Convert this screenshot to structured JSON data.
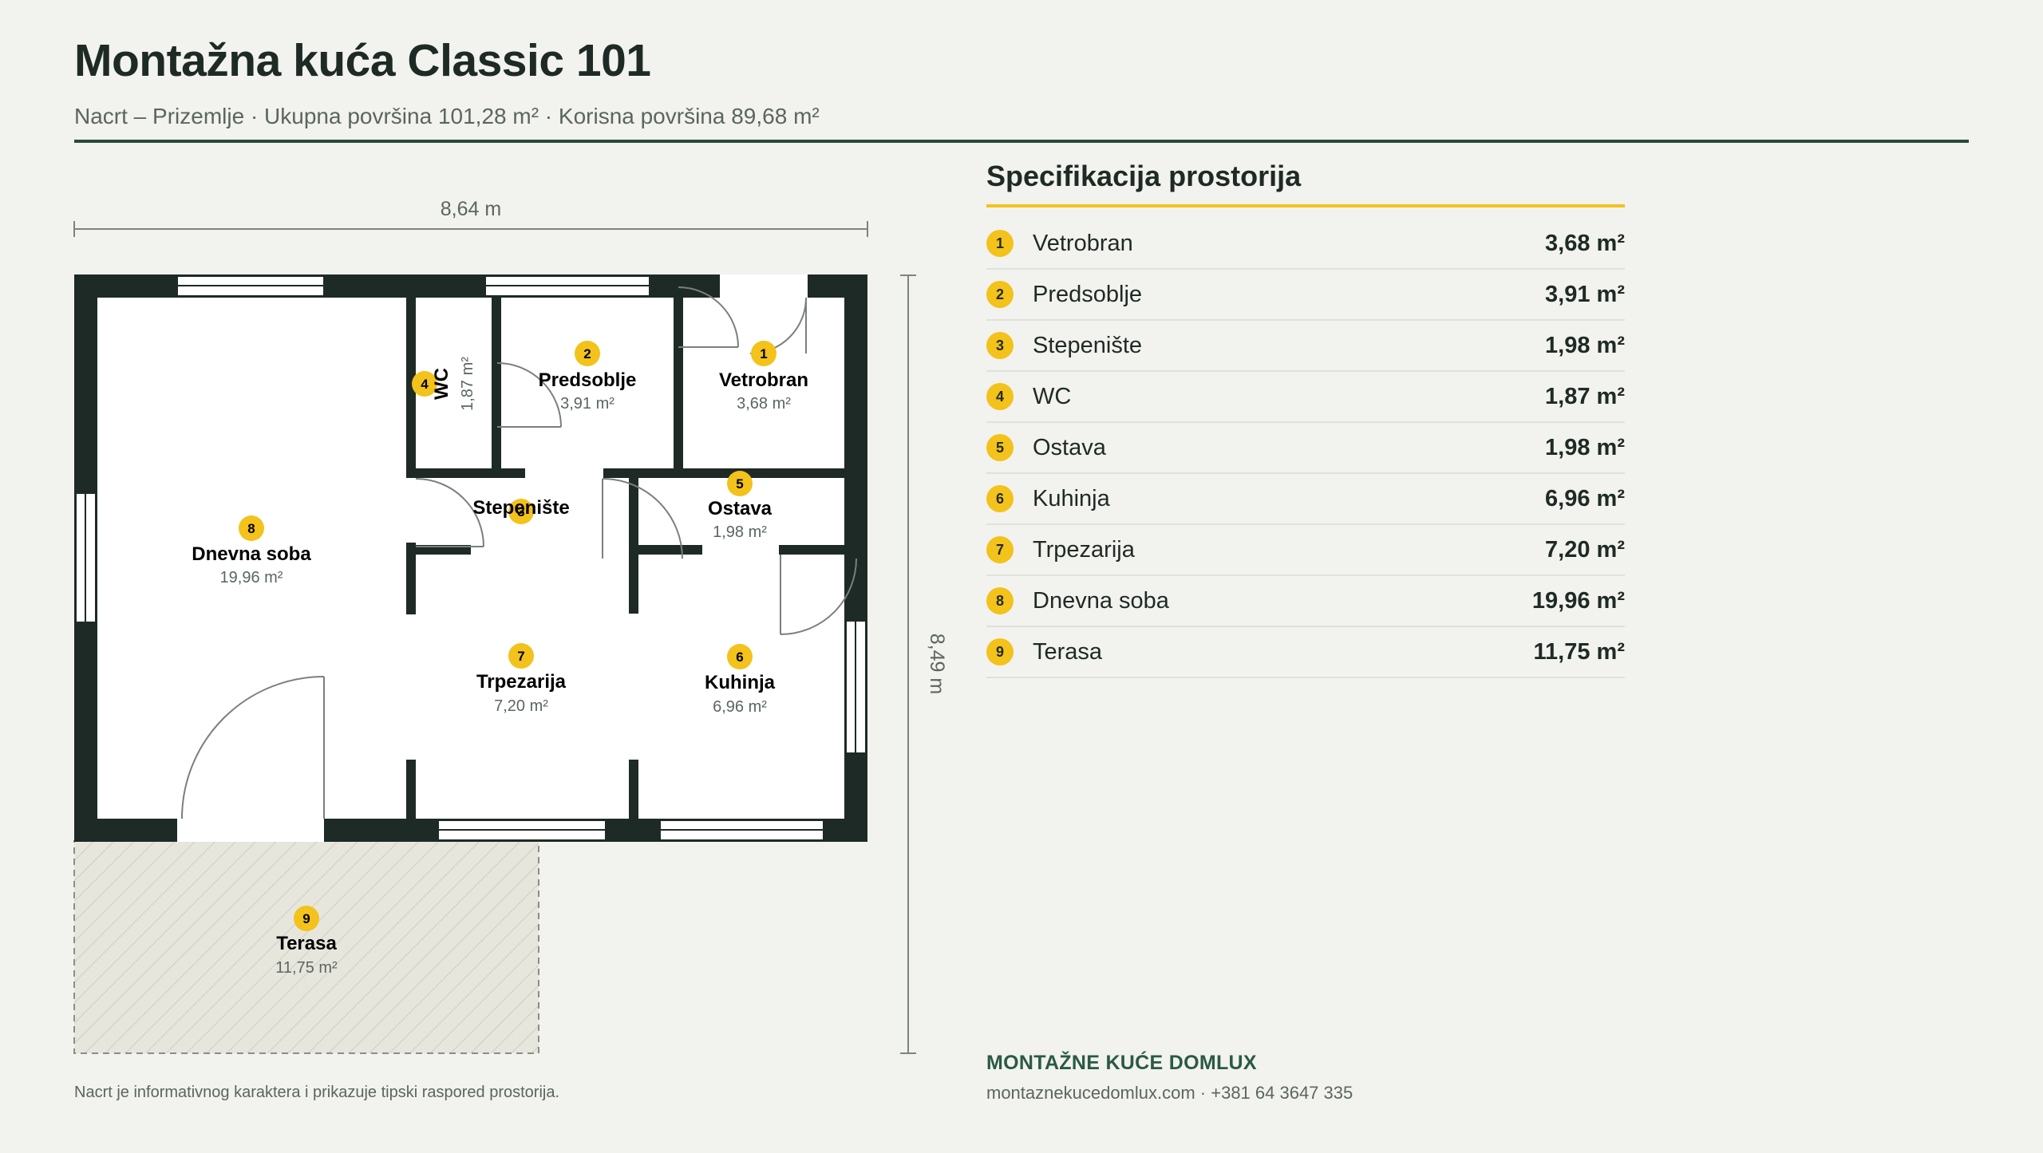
{
  "header": {
    "title": "Montažna kuća Classic 101",
    "subtitle": "Nacrt – Prizemlje · Ukupna površina 101,28 m² · Korisna površina 89,68 m²"
  },
  "dimensions": {
    "width": "8,64 m",
    "height": "8,49 m"
  },
  "rooms": [
    {
      "num": "1",
      "name": "Vetrobran",
      "area": "3,68 m²"
    },
    {
      "num": "2",
      "name": "Predsoblje",
      "area": "3,91 m²"
    },
    {
      "num": "3",
      "name": "Stepenište",
      "area": "1,98 m²"
    },
    {
      "num": "4",
      "name": "WC",
      "area": "1,87 m²"
    },
    {
      "num": "5",
      "name": "Ostava",
      "area": "1,98 m²"
    },
    {
      "num": "6",
      "name": "Kuhinja",
      "area": "6,96 m²"
    },
    {
      "num": "7",
      "name": "Trpezarija",
      "area": "7,20 m²"
    },
    {
      "num": "8",
      "name": "Dnevna soba",
      "area": "19,96 m²"
    },
    {
      "num": "9",
      "name": "Terasa",
      "area": "11,75 m²"
    }
  ],
  "spec": {
    "title": "Specifikacija prostorija"
  },
  "footer": {
    "brand": "MONTAŽNE KUĆE DOMLUX",
    "contact": "montaznekucedomlux.com · +381 64 3647 335",
    "note": "Nacrt je informativnog karaktera i prikazuje tipski raspored prostorija."
  },
  "colors": {
    "wall": "#1e2a25",
    "accent": "#f3c21b",
    "brand": "#2a5a46",
    "background": "#f2f2ee"
  }
}
